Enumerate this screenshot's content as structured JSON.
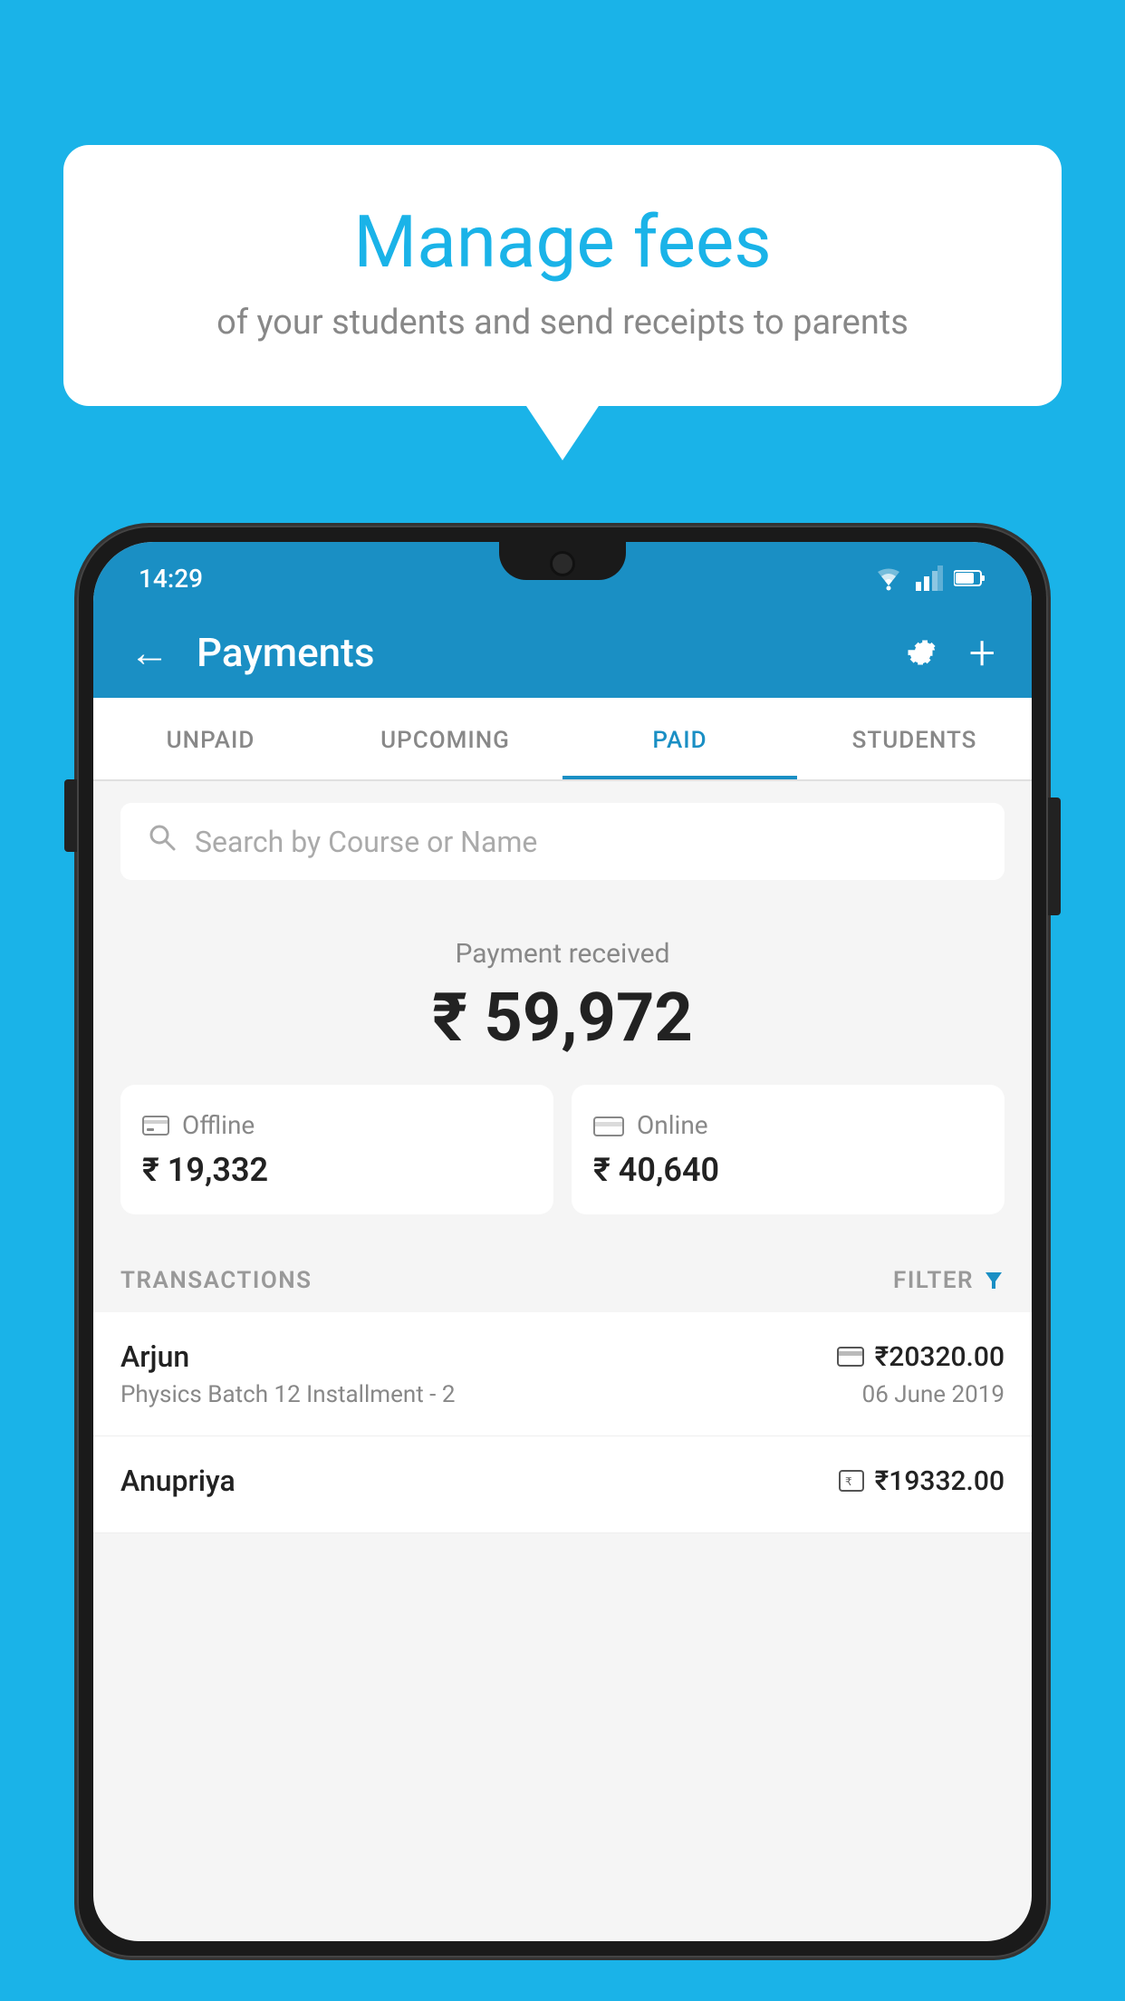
{
  "background_color": "#1ab3e8",
  "speech_bubble": {
    "title": "Manage fees",
    "subtitle": "of your students and send receipts to parents"
  },
  "status_bar": {
    "time": "14:29"
  },
  "header": {
    "title": "Payments",
    "back_label": "←"
  },
  "tabs": [
    {
      "label": "UNPAID",
      "active": false
    },
    {
      "label": "UPCOMING",
      "active": false
    },
    {
      "label": "PAID",
      "active": true
    },
    {
      "label": "STUDENTS",
      "active": false
    }
  ],
  "search": {
    "placeholder": "Search by Course or Name"
  },
  "payment_summary": {
    "label": "Payment received",
    "total": "₹ 59,972",
    "offline": {
      "type": "Offline",
      "amount": "₹ 19,332"
    },
    "online": {
      "type": "Online",
      "amount": "₹ 40,640"
    }
  },
  "transactions": {
    "label": "TRANSACTIONS",
    "filter_label": "FILTER",
    "items": [
      {
        "name": "Arjun",
        "amount": "₹20320.00",
        "course": "Physics Batch 12 Installment - 2",
        "date": "06 June 2019",
        "payment_type": "card"
      },
      {
        "name": "Anupriya",
        "amount": "₹19332.00",
        "course": "",
        "date": "",
        "payment_type": "cash"
      }
    ]
  }
}
